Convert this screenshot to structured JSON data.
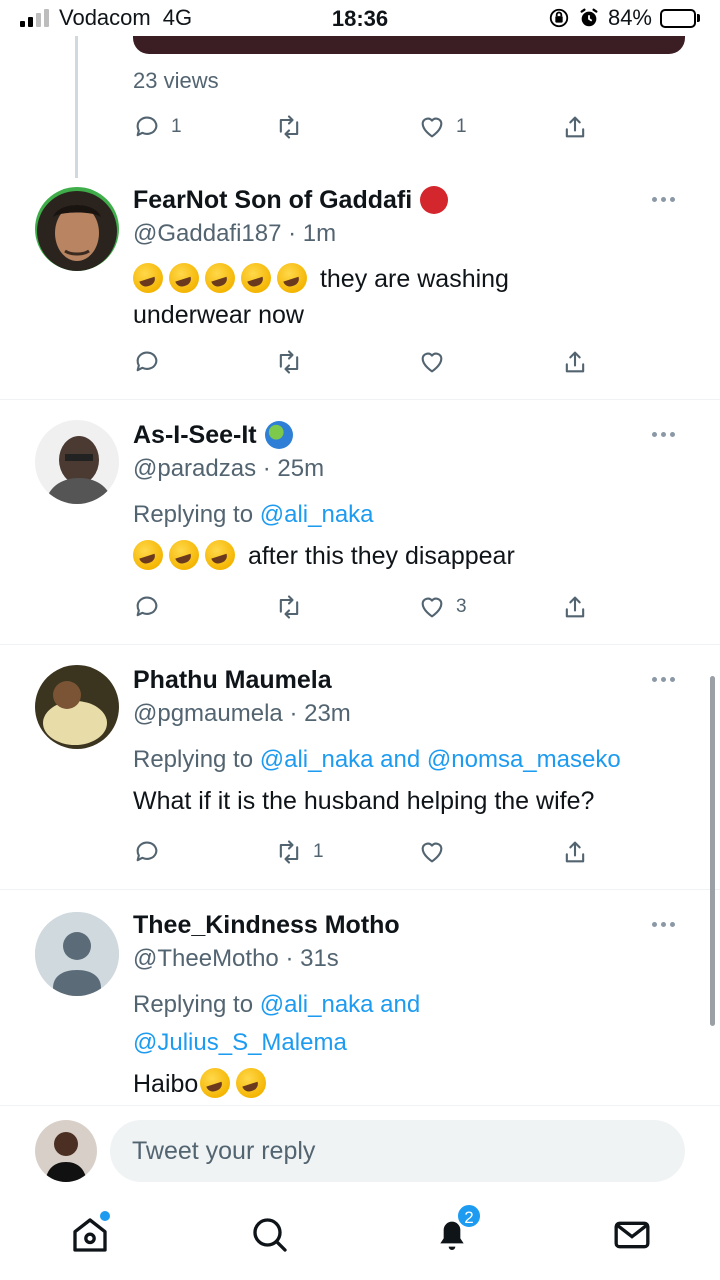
{
  "status_bar": {
    "carrier": "Vodacom",
    "network": "4G",
    "time": "18:36",
    "battery": "84%"
  },
  "top_tweet": {
    "views": "23 views",
    "reply_count": "1",
    "retweet_count": "",
    "like_count": "1"
  },
  "tweets": [
    {
      "name": "FearNot Son of Gaddafi",
      "handle": "@Gaddafi187",
      "time": "· 1m",
      "replying_prefix": "",
      "replying_to": "",
      "text": "they are washing",
      "text_line2": "underwear now",
      "reply_count": "",
      "retweet_count": "",
      "like_count": ""
    },
    {
      "name": "As-I-See-It",
      "handle": "@paradzas",
      "time": "· 25m",
      "replying_prefix": "Replying to",
      "replying_to": "@ali_naka",
      "text": "after this they disappear",
      "reply_count": "",
      "retweet_count": "",
      "like_count": "3"
    },
    {
      "name": "Phathu Maumela",
      "handle": "@pgmaumela",
      "time": "· 23m",
      "replying_prefix": "Replying to",
      "replying_to": "@ali_naka and @nomsa_maseko",
      "text": "What if it is the husband helping the wife?",
      "reply_count": "",
      "retweet_count": "1",
      "like_count": ""
    },
    {
      "name": "Thee_Kindness Motho",
      "handle": "@TheeMotho",
      "time": "· 31s",
      "replying_prefix": "Replying to",
      "replying_to": "@ali_naka and",
      "replying_to_line2": "@Julius_S_Malema",
      "text": "Haibo"
    }
  ],
  "reply_bar": {
    "placeholder": "Tweet your reply"
  },
  "bottom_nav": {
    "notifications_count": "2"
  },
  "colors": {
    "accent": "#1d9bf0",
    "secondary_text": "#536471",
    "divider": "#eff3f4"
  }
}
